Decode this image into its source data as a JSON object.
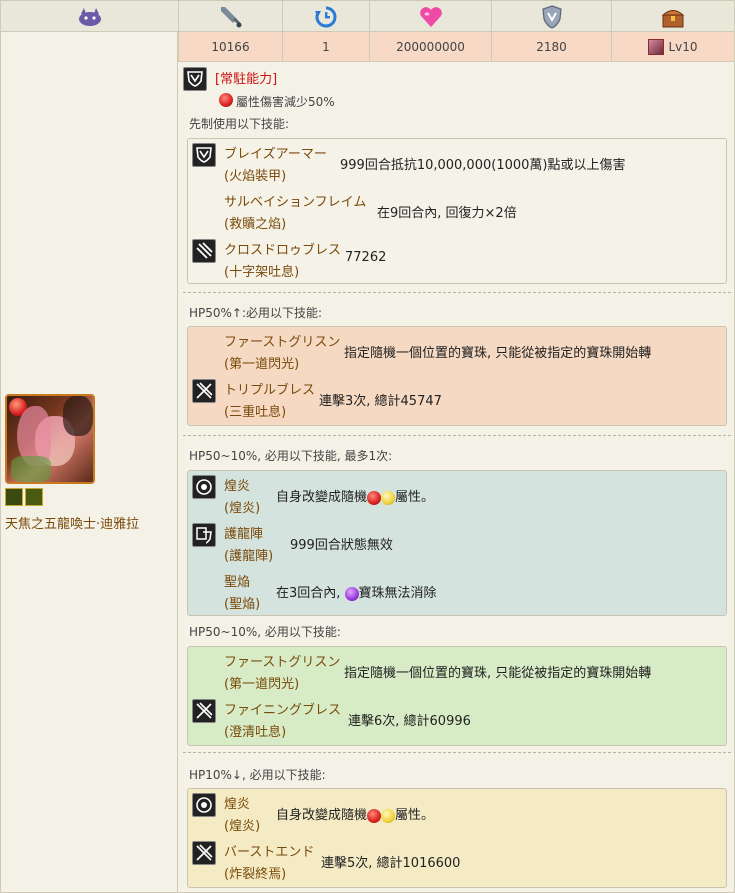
{
  "header": {
    "icons": [
      "monster-icon",
      "sword-icon",
      "turn-icon",
      "heart-icon",
      "shield-icon",
      "treasure-icon"
    ],
    "values": [
      "10166",
      "1",
      "200000000",
      "2180",
      "Lv10"
    ]
  },
  "monster": {
    "name": "天焦之五龍喚士·迪雅拉"
  },
  "passive": {
    "label": "[常駐能力]",
    "text": "屬性傷害減少50%"
  },
  "sections": {
    "preemptive": "先制使用以下技能:",
    "hp50up": "HP50%↑:必用以下技能:",
    "hp50_10_once": "HP50~10%, 必用以下技能, 最多1次:",
    "hp50_10": "HP50~10%, 必用以下技能:",
    "hp10": "HP10%↓, 必用以下技能:"
  },
  "skills": {
    "s1": {
      "jp": "ブレイズアーマー",
      "cn": "(火焰裝甲)",
      "desc": "999回合抵抗10,000,000(1000萬)點或以上傷害"
    },
    "s2": {
      "jp": "サルベイションフレイム",
      "cn": "(救贖之焰)",
      "desc": "在9回合內, 回復力×2倍"
    },
    "s3": {
      "jp": "クロスドロゥブレス",
      "cn": "(十字架吐息)",
      "desc": "77262"
    },
    "s4": {
      "jp": "ファーストグリスン",
      "cn": "(第一道閃光)",
      "desc": "指定隨機一個位置的寶珠, 只能從被指定的寶珠開始轉"
    },
    "s5": {
      "jp": "トリプルブレス",
      "cn": "(三重吐息)",
      "desc": "連擊3次, 總計45747"
    },
    "s6": {
      "jp": "煌炎",
      "cn": "(煌炎)",
      "desc_a": "自身改變成隨機",
      "desc_b": "屬性。"
    },
    "s7": {
      "jp": "護龍陣",
      "cn": "(護龍陣)",
      "desc": "999回合狀態無效"
    },
    "s8": {
      "jp": "聖焔",
      "cn": "(聖焔)",
      "desc_a": "在3回合內,",
      "desc_b": "寶珠無法消除"
    },
    "s9": {
      "jp": "ファーストグリスン",
      "cn": "(第一道閃光)",
      "desc": "指定隨機一個位置的寶珠, 只能從被指定的寶珠開始轉"
    },
    "s10": {
      "jp": "ファイニングブレス",
      "cn": "(澄清吐息)",
      "desc": "連擊6次, 總計60996"
    },
    "s11": {
      "jp": "煌炎",
      "cn": "(煌炎)",
      "desc_a": "自身改變成隨機",
      "desc_b": "屬性。"
    },
    "s12": {
      "jp": "バーストエンド",
      "cn": "(炸裂終焉)",
      "desc": "連擊5次, 總計1016600"
    }
  }
}
